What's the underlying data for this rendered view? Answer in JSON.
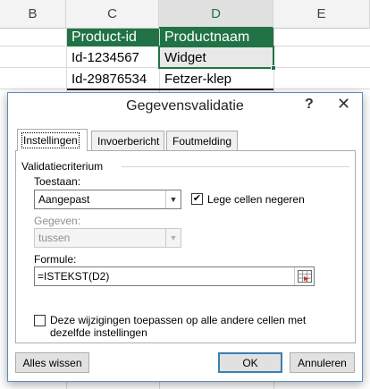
{
  "sheet": {
    "columns": [
      "B",
      "C",
      "D",
      "E"
    ],
    "header_row": [
      "Product-id",
      "Productnaam"
    ],
    "rows": [
      [
        "Id-1234567",
        "Widget"
      ],
      [
        "Id-29876534",
        "Fetzer-klep"
      ]
    ]
  },
  "dialog": {
    "title": "Gegevensvalidatie",
    "help_glyph": "?",
    "close_glyph": "✕",
    "tabs": [
      "Instellingen",
      "Invoerbericht",
      "Foutmelding"
    ],
    "section_title": "Validatiecriterium",
    "allow_label": "Toestaan:",
    "allow_value": "Aangepast",
    "ignore_blank_label": "Lege cellen negeren",
    "ignore_blank_checked": true,
    "data_label": "Gegeven:",
    "data_value": "tussen",
    "formula_label": "Formule:",
    "formula_value": "=ISTEKST(D2)",
    "apply_all_label": "Deze wijzigingen toepassen op alle andere cellen met dezelfde instellingen",
    "apply_all_checked": false,
    "buttons": {
      "clear_all": "Alles wissen",
      "ok": "OK",
      "cancel": "Annuleren"
    }
  },
  "colors": {
    "excel_green": "#217346",
    "dialog_border": "#5a8cc8"
  }
}
